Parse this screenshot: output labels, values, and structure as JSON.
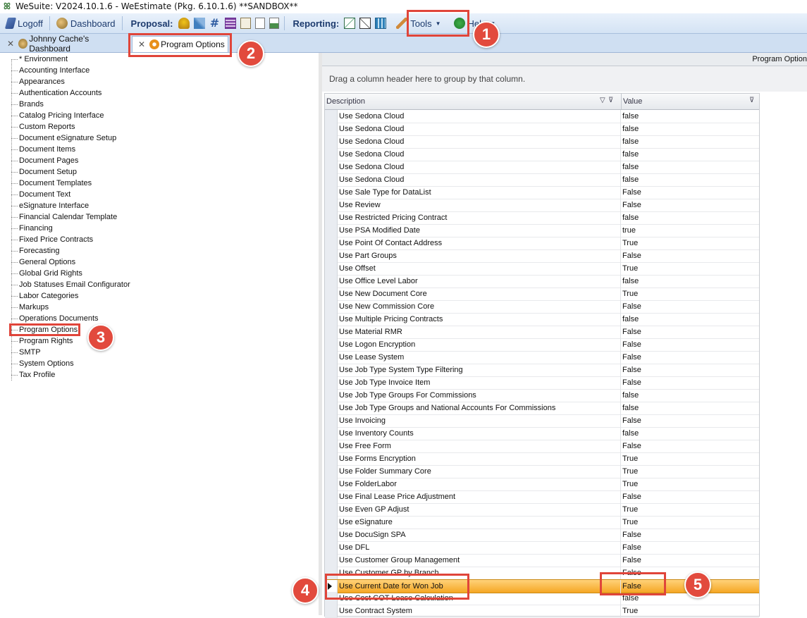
{
  "window": {
    "title": "WeSuite: V2024.10.1.6 - WeEstimate (Pkg. 6.10.1.6) **SANDBOX**"
  },
  "toolbar": {
    "logoff": "Logoff",
    "dashboard": "Dashboard",
    "proposal_label": "Proposal:",
    "reporting_label": "Reporting:",
    "tools": "Tools",
    "help": "Help"
  },
  "tabs": [
    {
      "label": "Johnny Cache's Dashboard"
    },
    {
      "label": "Program Options"
    }
  ],
  "tree": [
    "* Environment",
    "Accounting Interface",
    "Appearances",
    "Authentication Accounts",
    "Brands",
    "Catalog Pricing Interface",
    "Custom Reports",
    "Document eSignature Setup",
    "Document Items",
    "Document Pages",
    "Document Setup",
    "Document Templates",
    "Document Text",
    "eSignature Interface",
    "Financial Calendar Template",
    "Financing",
    "Fixed Price Contracts",
    "Forecasting",
    "General Options",
    "Global Grid Rights",
    "Job Statuses Email Configurator",
    "Labor Categories",
    "Markups",
    "Operations Documents",
    "Program Options",
    "Program Rights",
    "SMTP",
    "System Options",
    "Tax Profile"
  ],
  "right": {
    "header": "Program Option",
    "group_hint": "Drag a column header here to group by that column.",
    "col_description": "Description",
    "col_value": "Value"
  },
  "rows": [
    {
      "d": "Use Sedona Cloud",
      "v": "false"
    },
    {
      "d": "Use Sedona Cloud",
      "v": "false"
    },
    {
      "d": "Use Sedona Cloud",
      "v": "false"
    },
    {
      "d": "Use Sedona Cloud",
      "v": "false"
    },
    {
      "d": "Use Sedona Cloud",
      "v": "false"
    },
    {
      "d": "Use Sedona Cloud",
      "v": "false"
    },
    {
      "d": "Use Sale Type for DataList",
      "v": "False"
    },
    {
      "d": "Use Review",
      "v": "False"
    },
    {
      "d": "Use Restricted Pricing Contract",
      "v": "false"
    },
    {
      "d": "Use PSA Modified Date",
      "v": "true"
    },
    {
      "d": "Use Point Of Contact Address",
      "v": "True"
    },
    {
      "d": "Use Part Groups",
      "v": "False"
    },
    {
      "d": "Use Offset",
      "v": "True"
    },
    {
      "d": "Use Office Level Labor",
      "v": "false"
    },
    {
      "d": "Use New Document Core",
      "v": "True"
    },
    {
      "d": "Use New Commission Core",
      "v": "False"
    },
    {
      "d": "Use Multiple Pricing Contracts",
      "v": "false"
    },
    {
      "d": "Use Material RMR",
      "v": "False"
    },
    {
      "d": "Use Logon Encryption",
      "v": "False"
    },
    {
      "d": "Use Lease System",
      "v": "False"
    },
    {
      "d": "Use Job Type System Type Filtering",
      "v": "False"
    },
    {
      "d": "Use Job Type Invoice Item",
      "v": "False"
    },
    {
      "d": "Use Job Type Groups For Commissions",
      "v": "false"
    },
    {
      "d": "Use Job Type Groups and National Accounts For Commissions",
      "v": "false"
    },
    {
      "d": "Use Invoicing",
      "v": "False"
    },
    {
      "d": "Use Inventory Counts",
      "v": "false"
    },
    {
      "d": "Use Free Form",
      "v": "False"
    },
    {
      "d": "Use Forms Encryption",
      "v": "True"
    },
    {
      "d": "Use Folder Summary Core",
      "v": "True"
    },
    {
      "d": "Use FolderLabor",
      "v": "True"
    },
    {
      "d": "Use Final Lease Price Adjustment",
      "v": "False"
    },
    {
      "d": "Use Even GP Adjust",
      "v": "True"
    },
    {
      "d": "Use eSignature",
      "v": "True"
    },
    {
      "d": "Use DocuSign SPA",
      "v": "False"
    },
    {
      "d": "Use DFL",
      "v": "False"
    },
    {
      "d": "Use Customer Group Management",
      "v": "False"
    },
    {
      "d": "Use Customer GP by Branch",
      "v": "False"
    },
    {
      "d": "Use Current Date for Won Job",
      "v": "False"
    },
    {
      "d": "Use Cost COT Lease Calculation",
      "v": "false"
    },
    {
      "d": "Use Contract System",
      "v": "True"
    }
  ],
  "highlighted_row": "Use Current Date for Won Job",
  "badges": [
    "1",
    "2",
    "3",
    "4",
    "5"
  ],
  "colors": {
    "accent": "#e24a3d",
    "selection": "#f5a623",
    "toolbar": "#d4e3f4"
  }
}
